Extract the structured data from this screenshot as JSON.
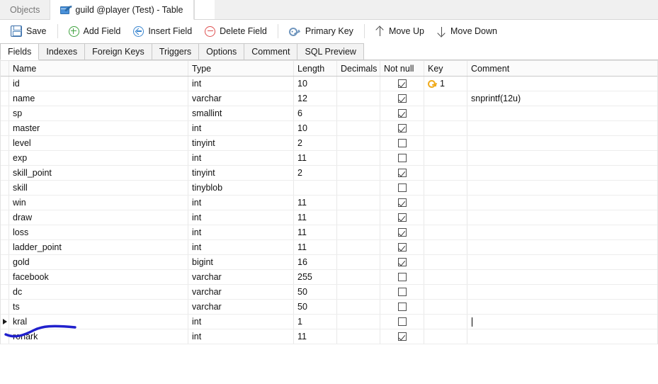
{
  "window_tabs": [
    {
      "label": "Objects",
      "active": false,
      "icon": "none"
    },
    {
      "label": "guild @player (Test) - Table",
      "active": true,
      "icon": "table-edit-icon"
    }
  ],
  "toolbar": {
    "buttons": [
      {
        "label": "Save",
        "icon": "save-icon"
      },
      {
        "label": "Add Field",
        "icon": "circle-plus-icon"
      },
      {
        "label": "Insert Field",
        "icon": "circle-left-arrow-icon"
      },
      {
        "label": "Delete Field",
        "icon": "circle-minus-icon"
      },
      {
        "label": "Primary Key",
        "icon": "key-icon"
      },
      {
        "label": "Move Up",
        "icon": "arrow-up-icon"
      },
      {
        "label": "Move Down",
        "icon": "arrow-down-icon"
      }
    ]
  },
  "inner_tabs": [
    {
      "label": "Fields",
      "active": true
    },
    {
      "label": "Indexes",
      "active": false
    },
    {
      "label": "Foreign Keys",
      "active": false
    },
    {
      "label": "Triggers",
      "active": false
    },
    {
      "label": "Options",
      "active": false
    },
    {
      "label": "Comment",
      "active": false
    },
    {
      "label": "SQL Preview",
      "active": false
    }
  ],
  "grid": {
    "columns": [
      "Name",
      "Type",
      "Length",
      "Decimals",
      "Not null",
      "Key",
      "Comment"
    ],
    "rows": [
      {
        "marker": false,
        "name": "id",
        "type": "int",
        "length": "10",
        "decimals": "",
        "not_null": true,
        "key": "1",
        "key_icon": true,
        "comment": "",
        "caret": false
      },
      {
        "marker": false,
        "name": "name",
        "type": "varchar",
        "length": "12",
        "decimals": "",
        "not_null": true,
        "key": "",
        "key_icon": false,
        "comment": "snprintf(12u)",
        "caret": false
      },
      {
        "marker": false,
        "name": "sp",
        "type": "smallint",
        "length": "6",
        "decimals": "",
        "not_null": true,
        "key": "",
        "key_icon": false,
        "comment": "",
        "caret": false
      },
      {
        "marker": false,
        "name": "master",
        "type": "int",
        "length": "10",
        "decimals": "",
        "not_null": true,
        "key": "",
        "key_icon": false,
        "comment": "",
        "caret": false
      },
      {
        "marker": false,
        "name": "level",
        "type": "tinyint",
        "length": "2",
        "decimals": "",
        "not_null": false,
        "key": "",
        "key_icon": false,
        "comment": "",
        "caret": false
      },
      {
        "marker": false,
        "name": "exp",
        "type": "int",
        "length": "11",
        "decimals": "",
        "not_null": false,
        "key": "",
        "key_icon": false,
        "comment": "",
        "caret": false
      },
      {
        "marker": false,
        "name": "skill_point",
        "type": "tinyint",
        "length": "2",
        "decimals": "",
        "not_null": true,
        "key": "",
        "key_icon": false,
        "comment": "",
        "caret": false
      },
      {
        "marker": false,
        "name": "skill",
        "type": "tinyblob",
        "length": "",
        "decimals": "",
        "not_null": false,
        "key": "",
        "key_icon": false,
        "comment": "",
        "caret": false
      },
      {
        "marker": false,
        "name": "win",
        "type": "int",
        "length": "11",
        "decimals": "",
        "not_null": true,
        "key": "",
        "key_icon": false,
        "comment": "",
        "caret": false
      },
      {
        "marker": false,
        "name": "draw",
        "type": "int",
        "length": "11",
        "decimals": "",
        "not_null": true,
        "key": "",
        "key_icon": false,
        "comment": "",
        "caret": false
      },
      {
        "marker": false,
        "name": "loss",
        "type": "int",
        "length": "11",
        "decimals": "",
        "not_null": true,
        "key": "",
        "key_icon": false,
        "comment": "",
        "caret": false
      },
      {
        "marker": false,
        "name": "ladder_point",
        "type": "int",
        "length": "11",
        "decimals": "",
        "not_null": true,
        "key": "",
        "key_icon": false,
        "comment": "",
        "caret": false
      },
      {
        "marker": false,
        "name": "gold",
        "type": "bigint",
        "length": "16",
        "decimals": "",
        "not_null": true,
        "key": "",
        "key_icon": false,
        "comment": "",
        "caret": false
      },
      {
        "marker": false,
        "name": "facebook",
        "type": "varchar",
        "length": "255",
        "decimals": "",
        "not_null": false,
        "key": "",
        "key_icon": false,
        "comment": "",
        "caret": false
      },
      {
        "marker": false,
        "name": "dc",
        "type": "varchar",
        "length": "50",
        "decimals": "",
        "not_null": false,
        "key": "",
        "key_icon": false,
        "comment": "",
        "caret": false
      },
      {
        "marker": false,
        "name": "ts",
        "type": "varchar",
        "length": "50",
        "decimals": "",
        "not_null": false,
        "key": "",
        "key_icon": false,
        "comment": "",
        "caret": false
      },
      {
        "marker": true,
        "name": "kral",
        "type": "int",
        "length": "1",
        "decimals": "",
        "not_null": false,
        "key": "",
        "key_icon": false,
        "comment": "",
        "caret": true
      },
      {
        "marker": false,
        "name": "ronark",
        "type": "int",
        "length": "11",
        "decimals": "",
        "not_null": true,
        "key": "",
        "key_icon": false,
        "comment": "",
        "caret": false
      }
    ]
  },
  "annotation": {
    "name": "blue-underline-scribble",
    "color": "#2020cc"
  }
}
